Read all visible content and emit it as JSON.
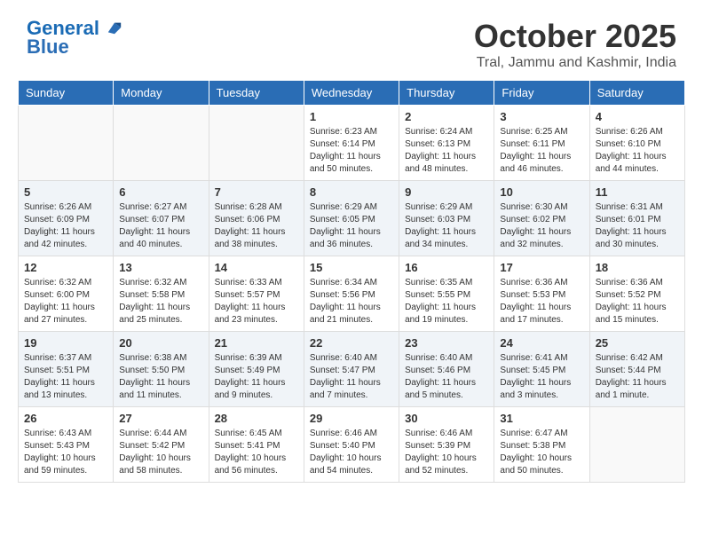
{
  "header": {
    "logo_line1": "General",
    "logo_line2": "Blue",
    "month": "October 2025",
    "location": "Tral, Jammu and Kashmir, India"
  },
  "days_of_week": [
    "Sunday",
    "Monday",
    "Tuesday",
    "Wednesday",
    "Thursday",
    "Friday",
    "Saturday"
  ],
  "weeks": [
    [
      {
        "day": "",
        "info": ""
      },
      {
        "day": "",
        "info": ""
      },
      {
        "day": "",
        "info": ""
      },
      {
        "day": "1",
        "info": "Sunrise: 6:23 AM\nSunset: 6:14 PM\nDaylight: 11 hours\nand 50 minutes."
      },
      {
        "day": "2",
        "info": "Sunrise: 6:24 AM\nSunset: 6:13 PM\nDaylight: 11 hours\nand 48 minutes."
      },
      {
        "day": "3",
        "info": "Sunrise: 6:25 AM\nSunset: 6:11 PM\nDaylight: 11 hours\nand 46 minutes."
      },
      {
        "day": "4",
        "info": "Sunrise: 6:26 AM\nSunset: 6:10 PM\nDaylight: 11 hours\nand 44 minutes."
      }
    ],
    [
      {
        "day": "5",
        "info": "Sunrise: 6:26 AM\nSunset: 6:09 PM\nDaylight: 11 hours\nand 42 minutes."
      },
      {
        "day": "6",
        "info": "Sunrise: 6:27 AM\nSunset: 6:07 PM\nDaylight: 11 hours\nand 40 minutes."
      },
      {
        "day": "7",
        "info": "Sunrise: 6:28 AM\nSunset: 6:06 PM\nDaylight: 11 hours\nand 38 minutes."
      },
      {
        "day": "8",
        "info": "Sunrise: 6:29 AM\nSunset: 6:05 PM\nDaylight: 11 hours\nand 36 minutes."
      },
      {
        "day": "9",
        "info": "Sunrise: 6:29 AM\nSunset: 6:03 PM\nDaylight: 11 hours\nand 34 minutes."
      },
      {
        "day": "10",
        "info": "Sunrise: 6:30 AM\nSunset: 6:02 PM\nDaylight: 11 hours\nand 32 minutes."
      },
      {
        "day": "11",
        "info": "Sunrise: 6:31 AM\nSunset: 6:01 PM\nDaylight: 11 hours\nand 30 minutes."
      }
    ],
    [
      {
        "day": "12",
        "info": "Sunrise: 6:32 AM\nSunset: 6:00 PM\nDaylight: 11 hours\nand 27 minutes."
      },
      {
        "day": "13",
        "info": "Sunrise: 6:32 AM\nSunset: 5:58 PM\nDaylight: 11 hours\nand 25 minutes."
      },
      {
        "day": "14",
        "info": "Sunrise: 6:33 AM\nSunset: 5:57 PM\nDaylight: 11 hours\nand 23 minutes."
      },
      {
        "day": "15",
        "info": "Sunrise: 6:34 AM\nSunset: 5:56 PM\nDaylight: 11 hours\nand 21 minutes."
      },
      {
        "day": "16",
        "info": "Sunrise: 6:35 AM\nSunset: 5:55 PM\nDaylight: 11 hours\nand 19 minutes."
      },
      {
        "day": "17",
        "info": "Sunrise: 6:36 AM\nSunset: 5:53 PM\nDaylight: 11 hours\nand 17 minutes."
      },
      {
        "day": "18",
        "info": "Sunrise: 6:36 AM\nSunset: 5:52 PM\nDaylight: 11 hours\nand 15 minutes."
      }
    ],
    [
      {
        "day": "19",
        "info": "Sunrise: 6:37 AM\nSunset: 5:51 PM\nDaylight: 11 hours\nand 13 minutes."
      },
      {
        "day": "20",
        "info": "Sunrise: 6:38 AM\nSunset: 5:50 PM\nDaylight: 11 hours\nand 11 minutes."
      },
      {
        "day": "21",
        "info": "Sunrise: 6:39 AM\nSunset: 5:49 PM\nDaylight: 11 hours\nand 9 minutes."
      },
      {
        "day": "22",
        "info": "Sunrise: 6:40 AM\nSunset: 5:47 PM\nDaylight: 11 hours\nand 7 minutes."
      },
      {
        "day": "23",
        "info": "Sunrise: 6:40 AM\nSunset: 5:46 PM\nDaylight: 11 hours\nand 5 minutes."
      },
      {
        "day": "24",
        "info": "Sunrise: 6:41 AM\nSunset: 5:45 PM\nDaylight: 11 hours\nand 3 minutes."
      },
      {
        "day": "25",
        "info": "Sunrise: 6:42 AM\nSunset: 5:44 PM\nDaylight: 11 hours\nand 1 minute."
      }
    ],
    [
      {
        "day": "26",
        "info": "Sunrise: 6:43 AM\nSunset: 5:43 PM\nDaylight: 10 hours\nand 59 minutes."
      },
      {
        "day": "27",
        "info": "Sunrise: 6:44 AM\nSunset: 5:42 PM\nDaylight: 10 hours\nand 58 minutes."
      },
      {
        "day": "28",
        "info": "Sunrise: 6:45 AM\nSunset: 5:41 PM\nDaylight: 10 hours\nand 56 minutes."
      },
      {
        "day": "29",
        "info": "Sunrise: 6:46 AM\nSunset: 5:40 PM\nDaylight: 10 hours\nand 54 minutes."
      },
      {
        "day": "30",
        "info": "Sunrise: 6:46 AM\nSunset: 5:39 PM\nDaylight: 10 hours\nand 52 minutes."
      },
      {
        "day": "31",
        "info": "Sunrise: 6:47 AM\nSunset: 5:38 PM\nDaylight: 10 hours\nand 50 minutes."
      },
      {
        "day": "",
        "info": ""
      }
    ]
  ]
}
